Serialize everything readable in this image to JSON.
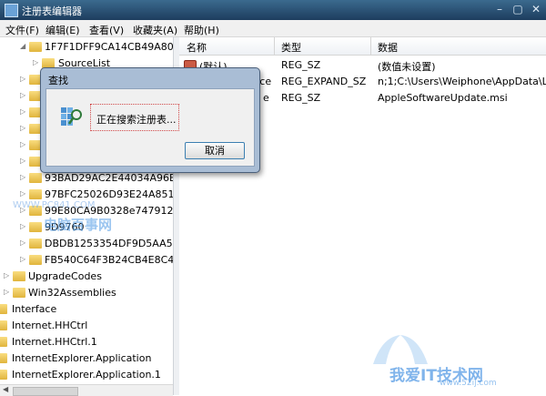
{
  "window": {
    "title": "注册表编辑器"
  },
  "menu": [
    "文件(F)",
    "编辑(E)",
    "查看(V)",
    "收藏夹(A)",
    "帮助(H)"
  ],
  "tree": {
    "nodes": [
      {
        "label": "1F7F1DFF9CA14CB49A80"
      },
      {
        "label": "SourceList"
      },
      {
        "label": "93BAD29AC2E44034A96E"
      },
      {
        "label": "97BFC25026D93E24A851"
      },
      {
        "label": "99E80CA9B0328e747912"
      },
      {
        "label": "9D9760"
      },
      {
        "label": "DBDB1253354DF9D5AA5"
      },
      {
        "label": "FB540C64F3B24CB4E8C4"
      },
      {
        "label": "UpgradeCodes"
      },
      {
        "label": "Win32Assemblies"
      },
      {
        "label": "Interface"
      },
      {
        "label": "Internet.HHCtrl"
      },
      {
        "label": "Internet.HHCtrl.1"
      },
      {
        "label": "InternetExplorer.Application"
      },
      {
        "label": "InternetExplorer.Application.1"
      }
    ]
  },
  "list": {
    "columns": [
      "名称",
      "类型",
      "数据"
    ],
    "rows": [
      {
        "name": "(默认)",
        "type": "REG_SZ",
        "data": "(数值未设置)"
      },
      {
        "name": "rce",
        "type": "REG_EXPAND_SZ",
        "data": "n;1;C:\\Users\\Weiphone\\AppData\\Lo"
      },
      {
        "name": "e",
        "type": "REG_SZ",
        "data": "AppleSoftwareUpdate.msi"
      }
    ]
  },
  "dialog": {
    "title": "查找",
    "message": "正在搜索注册表...",
    "cancel_label": "取消"
  },
  "watermarks": {
    "site1": "WWW.PC841.COM",
    "site1_cn": "电脑百事网",
    "site2_cn": "我爱IT技术网",
    "site2_url": "www.52ij.com"
  },
  "colors": {
    "titlebar": "#1d3d5e",
    "dialog_frame": "#a9bdd5",
    "folder": "#e0b43c"
  }
}
